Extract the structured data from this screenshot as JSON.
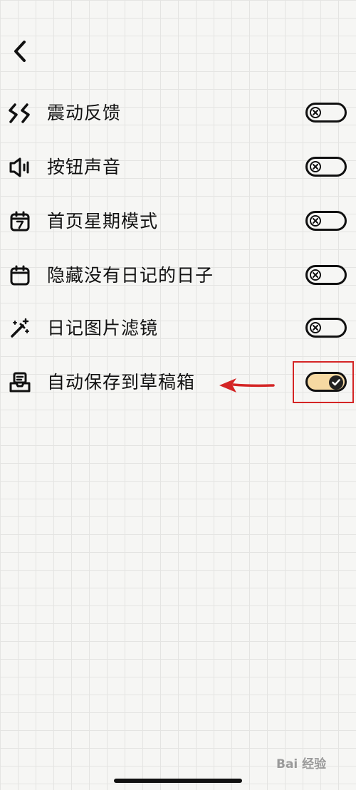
{
  "settings": {
    "items": [
      {
        "label": "震动反馈",
        "icon": "vibration-icon",
        "enabled": false
      },
      {
        "label": "按钮声音",
        "icon": "speaker-icon",
        "enabled": false
      },
      {
        "label": "首页星期模式",
        "icon": "calendar-week-icon",
        "enabled": false
      },
      {
        "label": "隐藏没有日记的日子",
        "icon": "calendar-icon",
        "enabled": false
      },
      {
        "label": "日记图片滤镜",
        "icon": "magic-wand-icon",
        "enabled": false
      },
      {
        "label": "自动保存到草稿箱",
        "icon": "drafts-box-icon",
        "enabled": true
      }
    ]
  },
  "watermark": {
    "text": "Bai 经验"
  },
  "colors": {
    "toggle_on": "#f6d9a2",
    "highlight": "#d42525",
    "ink": "#111111"
  }
}
